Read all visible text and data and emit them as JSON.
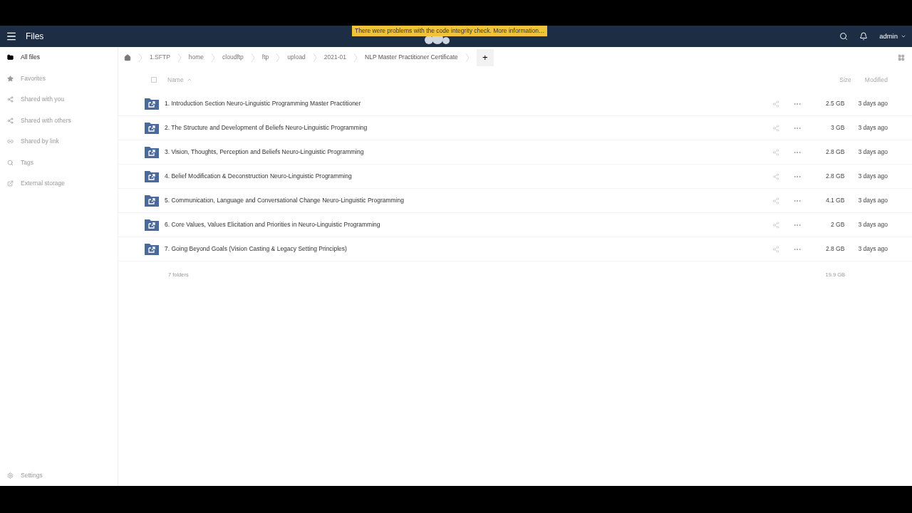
{
  "header": {
    "app_title": "Files",
    "notice": "There were problems with the code integrity check. More information…",
    "user": "admin"
  },
  "sidebar": {
    "items": [
      {
        "label": "All files",
        "selected": true
      },
      {
        "label": "Favorites",
        "selected": false
      },
      {
        "label": "Shared with you",
        "selected": false
      },
      {
        "label": "Shared with others",
        "selected": false
      },
      {
        "label": "Shared by link",
        "selected": false
      },
      {
        "label": "Tags",
        "selected": false
      },
      {
        "label": "External storage",
        "selected": false
      }
    ],
    "settings": "Settings"
  },
  "breadcrumbs": [
    "1.SFTP",
    "home",
    "cloudftp",
    "ftp",
    "upload",
    "2021-01",
    "NLP Master Practitioner Certificate"
  ],
  "new_button": "+",
  "table": {
    "select_all_checked": false,
    "columns": {
      "name": "Name",
      "size": "Size",
      "modified": "Modified"
    },
    "rows": [
      {
        "name": "1. Introduction Section Neuro-Linguistic Programming Master Practitioner",
        "size": "2.5 GB",
        "modified": "3 days ago"
      },
      {
        "name": "2. The Structure and Development of Beliefs Neuro-Linguistic Programming",
        "size": "3 GB",
        "modified": "3 days ago"
      },
      {
        "name": "3. Vision, Thoughts, Perception and Beliefs Neuro-Linguistic Programming",
        "size": "2.8 GB",
        "modified": "3 days ago"
      },
      {
        "name": "4. Belief Modification & Deconstruction Neuro-Linguistic Programming",
        "size": "2.8 GB",
        "modified": "3 days ago"
      },
      {
        "name": "5. Communication, Language and Conversational Change Neuro-Linguistic Programming",
        "size": "4.1 GB",
        "modified": "3 days ago"
      },
      {
        "name": "6. Core Values, Values Elicitation and Priorities in Neuro-Linguistic Programming",
        "size": "2 GB",
        "modified": "3 days ago"
      },
      {
        "name": "7. Going Beyond Goals (Vision Casting & Legacy Setting Principles)",
        "size": "2.8 GB",
        "modified": "3 days ago"
      }
    ],
    "summary": {
      "count": "7 folders",
      "total": "19.9 GB"
    }
  }
}
